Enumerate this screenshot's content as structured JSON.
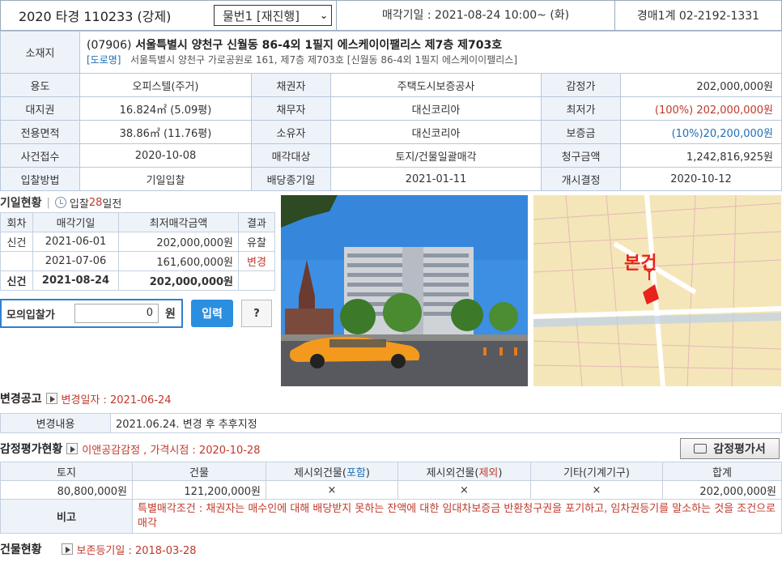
{
  "header": {
    "case_no": "2020 타경 110233 (강제)",
    "item_select": "물번1 [재진행]",
    "sale_date": "매각기일 : 2021-08-24 10:00~ (화)",
    "dept": "경매1계 02-2192-1331"
  },
  "info": {
    "address_label": "소재지",
    "address_zip": "(07906)",
    "address_main": "서울특별시 양천구 신월동 86-4외 1필지 에스케이이팰리스 제7층 제703호",
    "road_tag": "[도로명]",
    "road_addr": "서울특별시 양천구 가로공원로 161, 제7층 제703호 [신월동 86-4외 1필지 에스케이이팰리스]",
    "rows": [
      [
        {
          "l": "용도",
          "v": "오피스텔(주거)"
        },
        {
          "l": "채권자",
          "v": "주택도시보증공사"
        },
        {
          "l": "감정가",
          "v": "202,000,000원"
        }
      ],
      [
        {
          "l": "대지권",
          "v": "16.824㎡ (5.09평)"
        },
        {
          "l": "채무자",
          "v": "대신코리아"
        },
        {
          "l": "최저가",
          "v": "(100%) 202,000,000원"
        }
      ],
      [
        {
          "l": "전용면적",
          "v": "38.86㎡ (11.76평)"
        },
        {
          "l": "소유자",
          "v": "대신코리아"
        },
        {
          "l": "보증금",
          "v": "(10%)20,200,000원"
        }
      ],
      [
        {
          "l": "사건접수",
          "v": "2020-10-08"
        },
        {
          "l": "매각대상",
          "v": "토지/건물일괄매각"
        },
        {
          "l": "청구금액",
          "v": "1,242,816,925원"
        }
      ],
      [
        {
          "l": "입찰방법",
          "v": "기일입찰"
        },
        {
          "l": "배당종기일",
          "v": "2021-01-11"
        },
        {
          "l": "개시결정",
          "v": "2020-10-12"
        }
      ]
    ]
  },
  "bid_history": {
    "title": "기일현황",
    "days_pre": "입찰",
    "days_num": "28",
    "days_post": "일전",
    "headers": [
      "회차",
      "매각기일",
      "최저매각금액",
      "결과"
    ],
    "rows": [
      [
        "신건",
        "2021-06-01",
        "202,000,000원",
        "유찰"
      ],
      [
        "",
        "2021-07-06",
        "161,600,000원",
        "변경"
      ],
      [
        "신건",
        "2021-08-24",
        "202,000,000원",
        ""
      ]
    ]
  },
  "mock_bid": {
    "label": "모의입찰가",
    "value": "0",
    "unit": "원",
    "bid_button": "입력",
    "help_button": "?"
  },
  "map": {
    "marker_label": "본건"
  },
  "change": {
    "title": "변경공고",
    "date": "변경일자 : 2021-06-24",
    "label": "변경내용",
    "content": "2021.06.24. 변경 후 추후지정"
  },
  "appraisal": {
    "title": "감정평가현황",
    "info": "이앤공감감정 , 가격시점 : 2020-10-28",
    "button": "감정평가서",
    "h_land": "토지",
    "h_bldg": "건물",
    "h_ex_in_pre": "제시외건물(",
    "h_ex_in_mid": "포함",
    "h_ex_in_post": ")",
    "h_ex_out_pre": "제시외건물(",
    "h_ex_out_mid": "제외",
    "h_ex_out_post": ")",
    "h_etc": "기타(기계기구)",
    "h_total": "합계",
    "v_land": "80,800,000원",
    "v_bldg": "121,200,000원",
    "v_ex_in": "×",
    "v_ex_out": "×",
    "v_etc": "×",
    "v_total": "202,000,000원",
    "note_label": "비고",
    "note": "특별매각조건 : 채권자는 매수인에 대해 배당받지 못하는 잔액에 대한 임대차보증금 반환청구권을 포기하고, 임차권등기를 말소하는 것을 조건으로 매각"
  },
  "building": {
    "title": "건물현황",
    "date": "보존등기일 : 2018-03-28"
  },
  "colors": {
    "accent": "#2b8fe0",
    "label_bg": "#eef3fa",
    "red": "#c0392b"
  }
}
